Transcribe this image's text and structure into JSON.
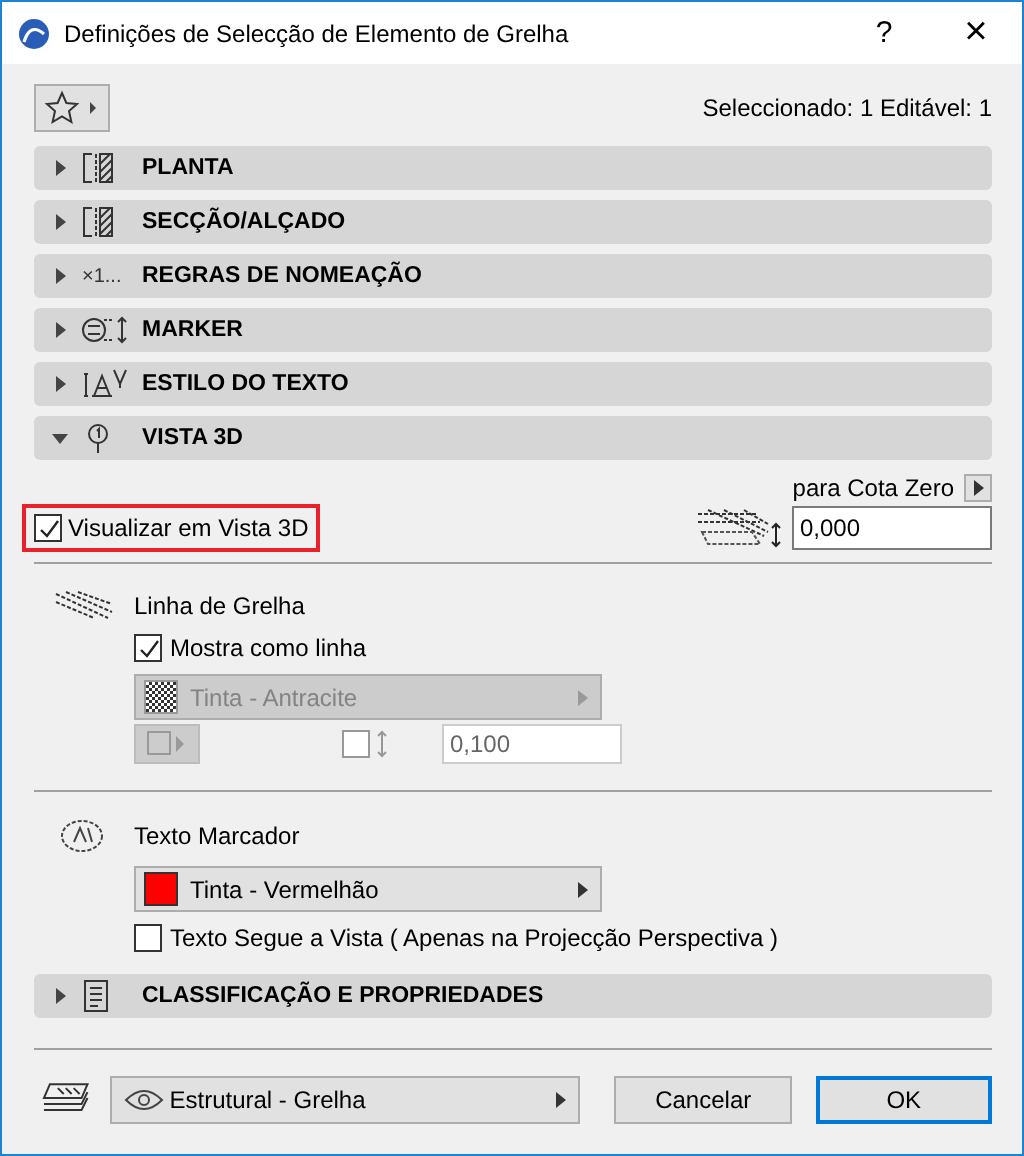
{
  "window": {
    "title": "Definições de Selecção de Elemento de Grelha",
    "help": "?",
    "close": "×"
  },
  "selection_info": "Seleccionado: 1 Editável: 1",
  "sections": [
    {
      "kind": "plan",
      "label": "PLANTA",
      "expanded": false
    },
    {
      "kind": "section",
      "label": "SECÇÃO/ALÇADO",
      "expanded": false
    },
    {
      "kind": "naming",
      "label": "REGRAS DE NOMEAÇÃO",
      "icon_text": "×1...",
      "expanded": false
    },
    {
      "kind": "marker",
      "label": "MARKER",
      "expanded": false
    },
    {
      "kind": "text",
      "label": "ESTILO DO TEXTO",
      "expanded": false
    },
    {
      "kind": "view3d",
      "label": "VISTA 3D",
      "expanded": true
    }
  ],
  "vista3d": {
    "reference_label": "para Cota Zero",
    "show_in_3d": {
      "label": "Visualizar em Vista 3D",
      "checked": true,
      "highlighted": true
    },
    "elevation": {
      "value": "0,000"
    },
    "grid_line": {
      "title": "Linha de Grelha",
      "show_as_line": {
        "label": "Mostra como linha",
        "checked": true
      },
      "pen": {
        "label": "Tinta - Antracite",
        "disabled": true
      },
      "thickness_checked": false,
      "thickness": {
        "value": "0,100",
        "disabled": true
      }
    },
    "marker_text": {
      "title": "Texto Marcador",
      "pen": {
        "label": "Tinta - Vermelhão",
        "disabled": false,
        "color": "#ff0000"
      },
      "follows_view": {
        "label": "Texto Segue a Vista ( Apenas na Projecção Perspectiva )",
        "checked": false
      }
    }
  },
  "classification": {
    "label": "CLASSIFICAÇÃO E PROPRIEDADES",
    "expanded": false
  },
  "footer": {
    "layer": "Estrutural - Grelha",
    "buttons": [
      {
        "label": "Cancelar",
        "default": false
      },
      {
        "label": "OK",
        "default": true
      }
    ]
  }
}
